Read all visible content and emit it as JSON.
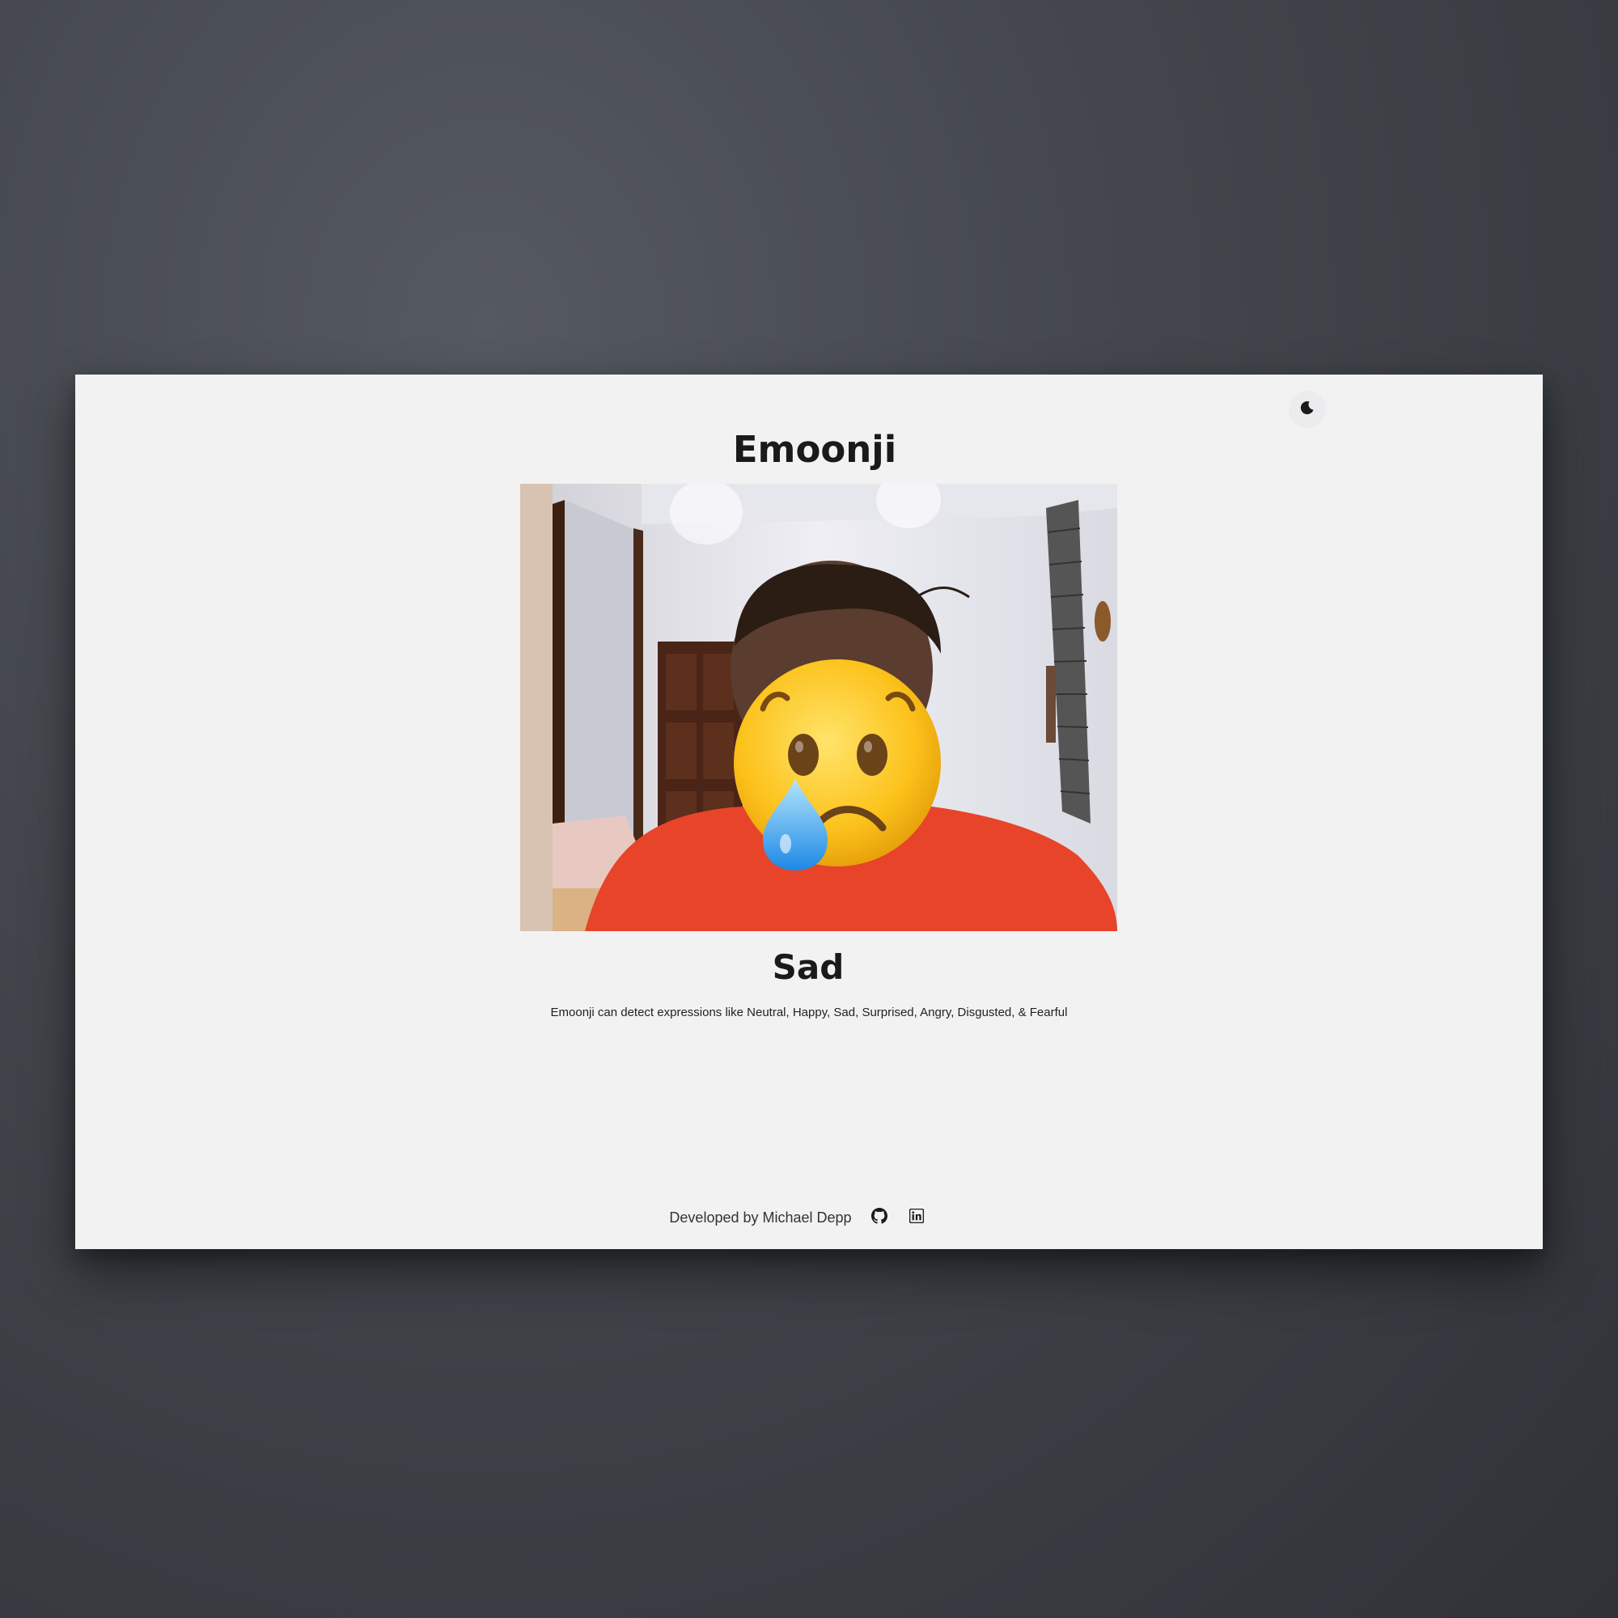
{
  "app": {
    "title": "Emoonji"
  },
  "header": {
    "theme_toggle_icon": "moon-icon"
  },
  "detection": {
    "emotion": "Sad",
    "emoji": "crying-face",
    "description": "Emoonji can detect expressions like Neutral, Happy, Sad, Surprised, Angry, Disgusted, & Fearful"
  },
  "footer": {
    "credit": "Developed by Michael Depp",
    "links": [
      {
        "icon": "github-icon"
      },
      {
        "icon": "linkedin-icon"
      }
    ]
  },
  "colors": {
    "background": "#43474d",
    "window": "#f2f2f2",
    "text": "#1a1a1a",
    "shirt": "#e8442a",
    "emoji_face": "#fbc02d",
    "tear": "#2196f3"
  }
}
